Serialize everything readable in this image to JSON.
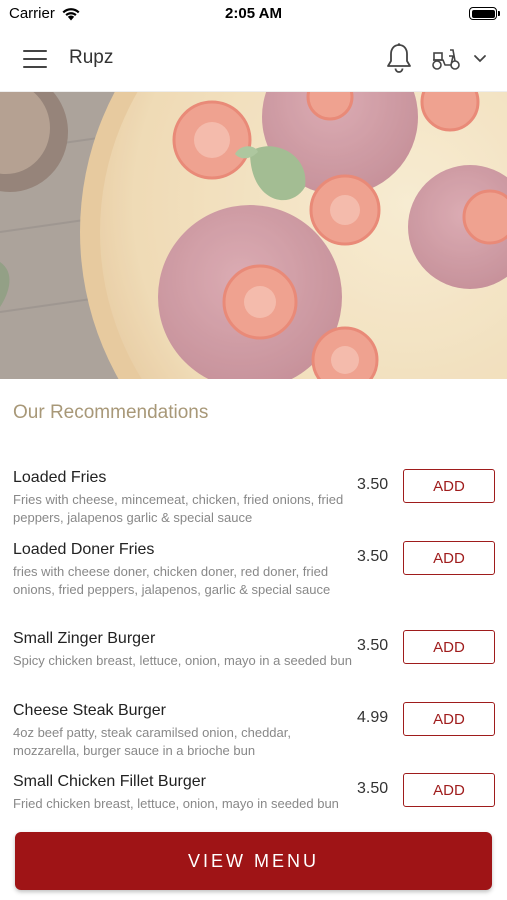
{
  "status_bar": {
    "carrier": "Carrier",
    "time": "2:05 AM"
  },
  "header": {
    "title": "Rupz",
    "icons": [
      "menu-icon",
      "bell-icon",
      "scooter-icon",
      "chevron-down-icon"
    ]
  },
  "section_title": "Our Recommendations",
  "items": [
    {
      "name": "Loaded Fries",
      "description": "Fries with cheese, mincemeat, chicken, fried onions, fried peppers, jalapenos garlic & special sauce",
      "price": "3.50",
      "button": "ADD"
    },
    {
      "name": "Loaded Doner Fries",
      "description": "fries with cheese doner, chicken doner, red doner, fried onions, fried peppers, jalapenos, garlic & special sauce",
      "price": "3.50",
      "button": "ADD"
    },
    {
      "name": "Small Zinger Burger",
      "description": "Spicy chicken breast, lettuce, onion, mayo in a seeded bun",
      "price": "3.50",
      "button": "ADD"
    },
    {
      "name": "Cheese Steak Burger",
      "description": "4oz beef patty, steak caramilsed onion, cheddar, mozzarella, burger sauce in a brioche bun",
      "price": "4.99",
      "button": "ADD"
    },
    {
      "name": "Small Chicken Fillet Burger",
      "description": "Fried chicken breast, lettuce, onion, mayo in seeded bun",
      "price": "3.50",
      "button": "ADD"
    }
  ],
  "view_menu_label": "VIEW MENU",
  "colors": {
    "accent": "#9f1416",
    "section_title": "#a89878"
  }
}
